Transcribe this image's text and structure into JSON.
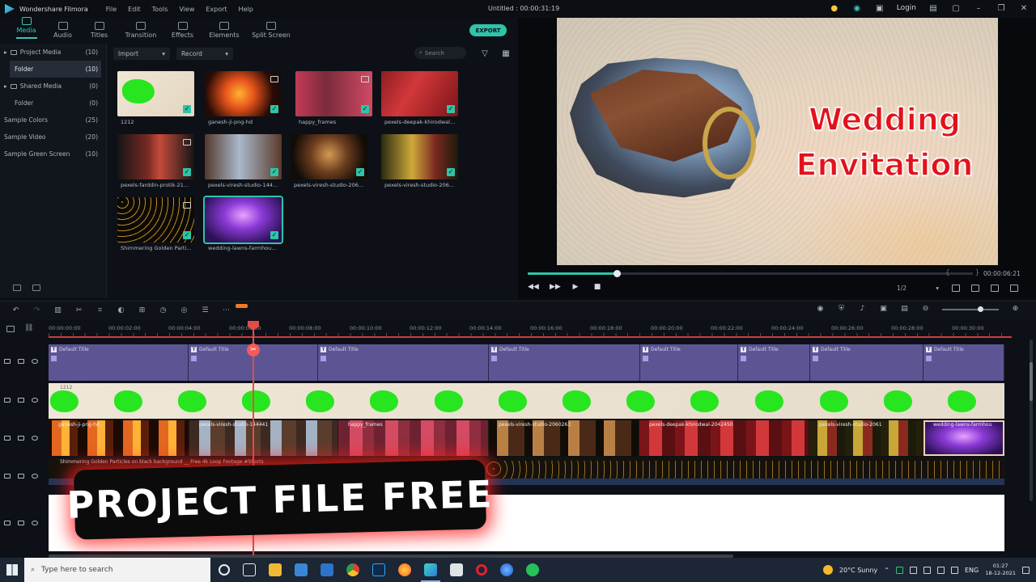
{
  "window": {
    "app_name": "Wondershare Filmora",
    "menu": [
      "File",
      "Edit",
      "Tools",
      "View",
      "Export",
      "Help"
    ],
    "project_title": "Untitled : 00:00:31:19",
    "login_label": "Login"
  },
  "tabs": [
    {
      "label": "Media",
      "icon": "media-icon",
      "active": true
    },
    {
      "label": "Audio",
      "icon": "music-note-icon",
      "active": false
    },
    {
      "label": "Titles",
      "icon": "text-t-icon",
      "active": false
    },
    {
      "label": "Transition",
      "icon": "transition-icon",
      "active": false
    },
    {
      "label": "Effects",
      "icon": "effects-icon",
      "active": false
    },
    {
      "label": "Elements",
      "icon": "elements-icon",
      "active": false
    },
    {
      "label": "Split Screen",
      "icon": "split-screen-icon",
      "active": false
    }
  ],
  "export_label": "EXPORT",
  "sidebar": {
    "items": [
      {
        "label": "Project Media",
        "count": "(10)"
      },
      {
        "label": "Folder",
        "count": "(10)"
      },
      {
        "label": "Shared Media",
        "count": "(0)"
      },
      {
        "label": "Folder",
        "count": "(0)"
      },
      {
        "label": "Sample Colors",
        "count": "(25)"
      },
      {
        "label": "Sample Video",
        "count": "(20)"
      },
      {
        "label": "Sample Green Screen",
        "count": "(10)"
      }
    ]
  },
  "media_toolbar": {
    "import_label": "Import",
    "record_label": "Record",
    "search_placeholder": "Search"
  },
  "media_items": [
    {
      "caption": "1212"
    },
    {
      "caption": "ganesh-ji-png-hd"
    },
    {
      "caption": "happy_frames"
    },
    {
      "caption": "pexels-deepak-khirodwal..."
    },
    {
      "caption": "pexels-farddin-protik-21..."
    },
    {
      "caption": "pexels-viresh-studio-144..."
    },
    {
      "caption": "pexels-viresh-studio-206..."
    },
    {
      "caption": "pexels-viresh-studio-206..."
    },
    {
      "caption": "Shimmering Golden Parti..."
    },
    {
      "caption": "wedding-lawns-farmhou..."
    }
  ],
  "preview": {
    "title_line1": "Wedding",
    "title_line2": "Envitation",
    "timecode": "00:00:06:21",
    "quality": "1/2",
    "playback_progress": 0.2
  },
  "ruler_labels": [
    "00:00:00:00",
    "00:00:02:00",
    "00:00:04:00",
    "00:00:06:00",
    "00:00:08:00",
    "00:00:10:00",
    "00:00:12:00",
    "00:00:14:00",
    "00:00:16:00",
    "00:00:18:00",
    "00:00:20:00",
    "00:00:22:00",
    "00:00:24:00",
    "00:00:26:00",
    "00:00:28:00",
    "00:00:30:00"
  ],
  "title_clip_label": "Default Title",
  "green_clip_label": "1212",
  "video_clip_labels": [
    "ganesh-ji-png-hd",
    "pexels-viresh-studio-144441",
    "happy_frames",
    "pexels-viresh-studio-2060263",
    "pexels-deepak-khirodwal-2042450",
    "pexels-viresh-studio-2061",
    "wedding-lawns-farmhou"
  ],
  "particle_clip_label": "Shimmering Golden Particles on black background __ Free 4k Loop Footage #Shorts",
  "banner_text": "PROJECT FILE FREE",
  "taskbar": {
    "search_placeholder": "Type here to search",
    "weather": "20°C  Sunny",
    "language": "ENG",
    "time": "01:27",
    "date": "18-12-2021"
  }
}
